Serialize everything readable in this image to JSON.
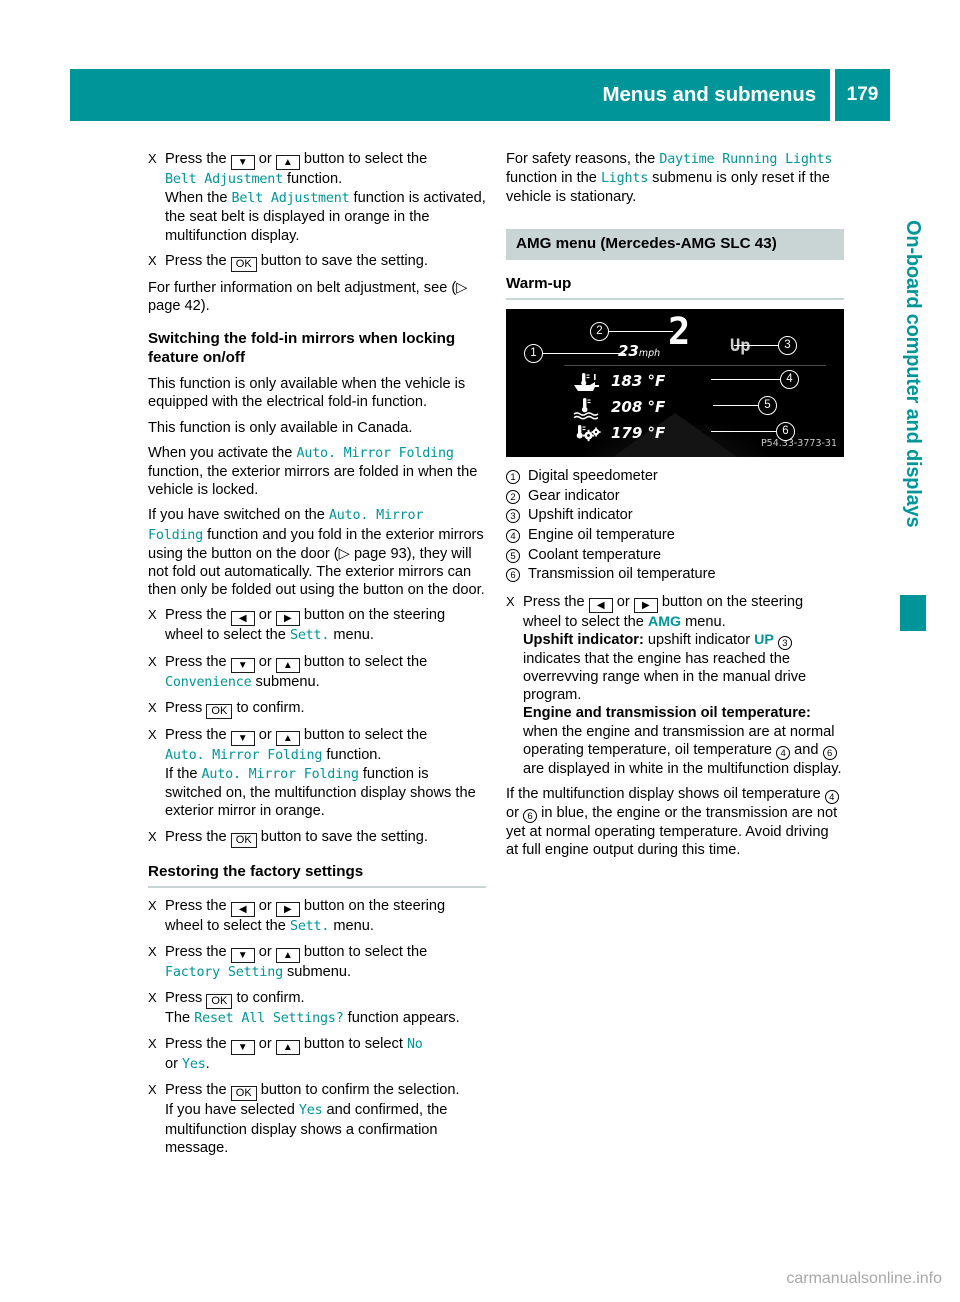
{
  "header": {
    "title": "Menus and submenus",
    "page_number": "179"
  },
  "side_tab": {
    "label": "On-board computer and displays"
  },
  "watermark": {
    "text": "carmanualsonline.info"
  },
  "keys": {
    "down": "▼",
    "up": "▲",
    "left": "◀",
    "right": "▶",
    "ok": "OK"
  },
  "left_column": {
    "step_belt_select": {
      "bullet": "X",
      "pre": "Press the",
      "mid": "or",
      "post": "button to select the",
      "term": "Belt Adjustment",
      "term_tail": "function.",
      "note_pre": "When the",
      "note_term": "Belt Adjustment",
      "note_post": "function is activated, the seat belt is displayed in orange in the multifunction display."
    },
    "step_belt_save": {
      "bullet": "X",
      "pre": "Press the",
      "post": "button to save the setting."
    },
    "para_further_info": "For further information on belt adjustment, see (▷ page 42).",
    "heading_fold_in": "Switching the fold-in mirrors when locking feature on/off",
    "para_equipped": "This function is only available when the vehicle is equipped with the electrical fold-in function.",
    "para_canada": "This function is only available in Canada.",
    "para_activate_pre": "When you activate the",
    "para_activate_term": "Auto. Mirror Folding",
    "para_activate_post": "function, the exterior mirrors are folded in when the vehicle is locked.",
    "para_switched_pre": "If you have switched on the",
    "para_switched_term": "Auto. Mirror Folding",
    "para_switched_post": "function and you fold in the exterior mirrors using the button on the door (▷ page 93), they will not fold out automatically. The exterior mirrors can then only be folded out using the button on the door.",
    "step_sett_menu": {
      "bullet": "X",
      "pre": "Press the",
      "mid": "or",
      "post": "button on the steering wheel to select the",
      "term": "Sett.",
      "tail": "menu."
    },
    "step_convenience": {
      "bullet": "X",
      "pre": "Press the",
      "mid": "or",
      "post": "button to select the",
      "term": "Convenience",
      "tail": "submenu."
    },
    "step_confirm": {
      "bullet": "X",
      "pre": "Press",
      "post": "to confirm."
    },
    "step_auto_mirror": {
      "bullet": "X",
      "pre": "Press the",
      "mid": "or",
      "post": "button to select the",
      "term": "Auto. Mirror Folding",
      "tail": "function.",
      "note_pre": "If the",
      "note_term": "Auto. Mirror Folding",
      "note_post": "function is switched on, the multifunction display shows the exterior mirror in orange."
    },
    "step_save": {
      "bullet": "X",
      "pre": "Press the",
      "post": "button to save the setting."
    },
    "heading_restoring": "Restoring the factory settings",
    "step_sett_menu2": {
      "bullet": "X",
      "pre": "Press the",
      "mid": "or",
      "post": "button on the steering wheel to select the",
      "term": "Sett.",
      "tail": "menu."
    },
    "step_factory_setting": {
      "bullet": "X",
      "pre": "Press the",
      "mid": "or",
      "post": "button to select the",
      "term": "Factory Setting",
      "tail": "submenu."
    },
    "step_confirm2": {
      "bullet": "X",
      "pre": "Press",
      "post": "to confirm.",
      "note_pre": "The",
      "note_term": "Reset All Settings?",
      "note_post": "function appears."
    },
    "step_no_yes": {
      "bullet": "X",
      "pre": "Press the",
      "mid": "or",
      "post": "button to select",
      "term_no": "No",
      "or": "or",
      "term_yes": "Yes",
      "tail": "."
    },
    "step_confirm_selection": {
      "bullet": "X",
      "pre": "Press the",
      "post": "button to confirm the selection.",
      "note_pre": "If you have selected",
      "note_term": "Yes",
      "note_post": "and confirmed, the multifunction display shows a confirmation message."
    }
  },
  "right_column": {
    "para_safety_pre": "For safety reasons, the",
    "para_safety_term1": "Daytime Running Lights",
    "para_safety_mid": "function in the",
    "para_safety_term2": "Lights",
    "para_safety_post": "submenu is only reset if the vehicle is stationary.",
    "section_band": "AMG menu (Mercedes-AMG SLC 43)",
    "heading_warmup": "Warm-up",
    "figure": {
      "gear": "2",
      "speed_value": "23",
      "speed_unit": "mph",
      "upshift": "Up",
      "engine_oil_temp": "183 °F",
      "coolant_temp": "208 °F",
      "transmission_oil_temp": "179 °F",
      "image_code": "P54.33-3773-31",
      "callouts": [
        "1",
        "2",
        "3",
        "4",
        "5",
        "6"
      ],
      "icons": {
        "engine_oil": "oil-can-thermometer-icon",
        "coolant": "coolant-thermometer-icon",
        "transmission_oil": "gear-thermometer-icon"
      }
    },
    "legend": [
      {
        "num": "1",
        "label": "Digital speedometer"
      },
      {
        "num": "2",
        "label": "Gear indicator"
      },
      {
        "num": "3",
        "label": "Upshift indicator"
      },
      {
        "num": "4",
        "label": "Engine oil temperature"
      },
      {
        "num": "5",
        "label": "Coolant temperature"
      },
      {
        "num": "6",
        "label": "Transmission oil temperature"
      }
    ],
    "step_amg_menu": {
      "bullet": "X",
      "pre": "Press the",
      "mid": "or",
      "post": "button on the steering wheel to select the",
      "term": "AMG",
      "tail": "menu."
    },
    "upshift_block": {
      "label": "Upshift indicator:",
      "pre": "upshift indicator",
      "term": "UP",
      "num": "3",
      "post": "indicates that the engine has reached the overrevving range when in the manual drive program."
    },
    "temp_block": {
      "label": "Engine and transmission oil temperature:",
      "text_pre": "when the engine and transmission are at normal operating temperature, oil temperature",
      "num1": "4",
      "mid": "and",
      "num2": "6",
      "text_post": "are displayed in white in the multifunction display."
    },
    "blue_block": {
      "pre": "If the multifunction display shows oil temperature",
      "num1": "4",
      "mid": "or",
      "num2": "6",
      "post": "in blue, the engine or the transmission are not yet at normal operating temperature. Avoid driving at full engine output during this time."
    }
  },
  "colors": {
    "accent_teal": "#009699",
    "band_gray": "#c9d4d4",
    "rule_gray": "#c9d4d4"
  }
}
